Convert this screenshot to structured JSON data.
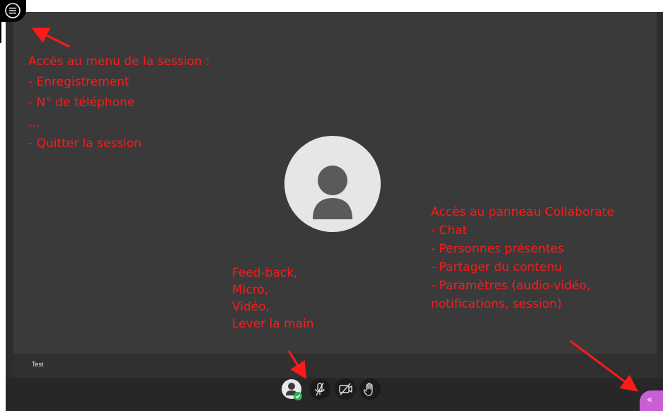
{
  "session": {
    "participant_name": "Test"
  },
  "icons": {
    "menu": "hamburger-menu-icon",
    "avatar": "user-avatar-icon",
    "feedback": "feedback-status-icon",
    "microphone": "microphone-muted-icon",
    "camera": "camera-off-icon",
    "raise_hand": "raise-hand-icon",
    "collaborate_panel": "double-chevron-left-icon"
  },
  "controls": {
    "collab_toggle_glyph": "«"
  },
  "annotations": {
    "menu": [
      "Accès au menu de la session :",
      "- Enregistrement",
      "- N° de téléphone",
      "...",
      "- Quitter la session"
    ],
    "controls": [
      "Feed-back,",
      "Micro,",
      "Vidéo,",
      "Lever la main"
    ],
    "collaborate": [
      "Accès au panneau Collaborate",
      "- Chat",
      "- Personnes présentes",
      "- Partager du contenu",
      "- Paramètres (audio-vidéo,",
      "notifications, session)"
    ]
  },
  "colors": {
    "annotation": "#ff1a1a",
    "stage": "#3a3a3a",
    "collaborate_accent": "#c85fd7",
    "status_ok": "#2bb24c"
  }
}
